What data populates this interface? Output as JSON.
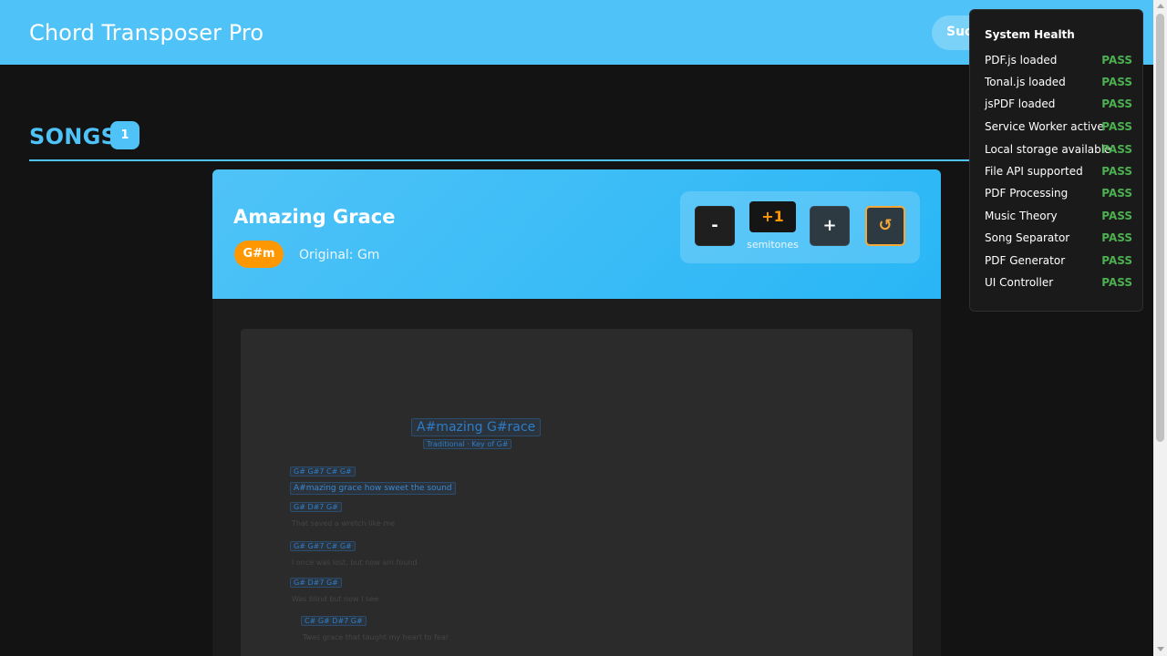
{
  "app": {
    "title": "Chord Transposer Pro",
    "header_pill": "Success"
  },
  "songs": {
    "heading": "SONGS",
    "count": "1"
  },
  "song": {
    "title": "Amazing Grace",
    "current_key": "G#m",
    "original_key": "Original: Gm",
    "controls": {
      "minus_label": "-",
      "semitones_value": "+1",
      "semitones_label": "semitones",
      "plus_label": "+",
      "reset_icon": "↺"
    }
  },
  "sheet": {
    "title": "A#mazing G#race",
    "subtitle": "Traditional · Key of G#",
    "lines": [
      {
        "type": "chord",
        "text": "G# G#7 C# G#"
      },
      {
        "type": "lyric_highlight",
        "text": "A#mazing grace how sweet the sound"
      },
      {
        "type": "chord",
        "text": "G# D#7 G#"
      },
      {
        "type": "lyric",
        "text": "That saved a wretch like me"
      },
      {
        "type": "chord",
        "text": "G# G#7 C# G#"
      },
      {
        "type": "lyric",
        "text": "I once was lost, but now am found"
      },
      {
        "type": "chord",
        "text": "G# D#7 G#"
      },
      {
        "type": "lyric",
        "text": "Was blind but now I see"
      },
      {
        "type": "chord",
        "text": "C# G# D#7 G#"
      },
      {
        "type": "lyric",
        "text": "Twas grace that taught my heart to fear"
      }
    ]
  },
  "health": {
    "title": "System Health",
    "items": [
      {
        "label": "PDF.js loaded",
        "status": "PASS"
      },
      {
        "label": "Tonal.js loaded",
        "status": "PASS"
      },
      {
        "label": "jsPDF loaded",
        "status": "PASS"
      },
      {
        "label": "Service Worker active",
        "status": "PASS"
      },
      {
        "label": "Local storage available",
        "status": "PASS"
      },
      {
        "label": "File API supported",
        "status": "PASS"
      },
      {
        "label": "PDF Processing",
        "status": "PASS"
      },
      {
        "label": "Music Theory",
        "status": "PASS"
      },
      {
        "label": "Song Separator",
        "status": "PASS"
      },
      {
        "label": "PDF Generator",
        "status": "PASS"
      },
      {
        "label": "UI Controller",
        "status": "PASS"
      }
    ]
  },
  "colors": {
    "accent": "#4fc3f7",
    "key_badge": "#ff9800",
    "pass": "#4caf50",
    "reset_border": "#f4a83a"
  }
}
